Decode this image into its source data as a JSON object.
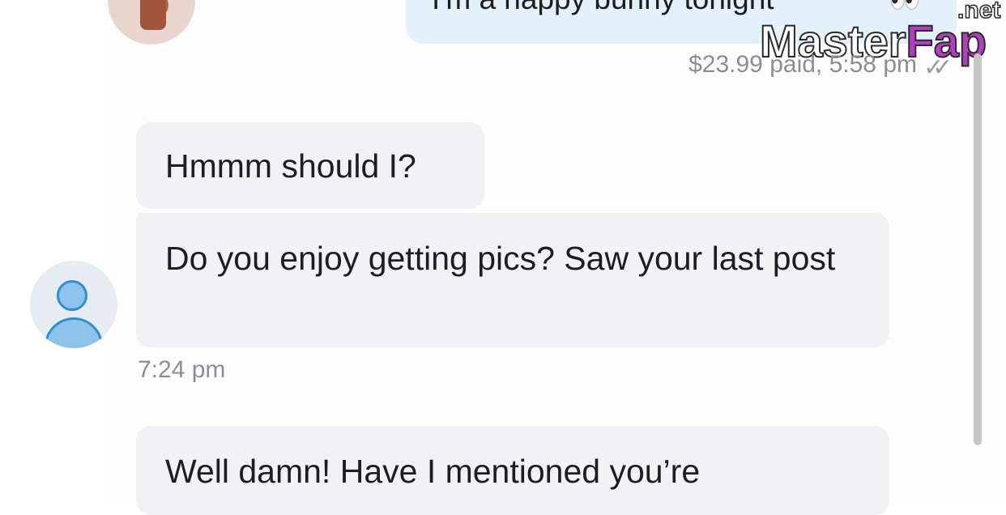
{
  "messages": {
    "outgoing": {
      "text": "I'm a happy bunny tonight",
      "emoji": "👀",
      "meta": "$23.99 paid,  5:58 pm",
      "read_icon": "double-check-icon"
    },
    "incoming": [
      {
        "text": "Hmmm should I?"
      },
      {
        "text": "Do you enjoy getting pics? Saw your last post",
        "time": "7:24 pm"
      },
      {
        "text": "Well damn! Have I mentioned you’re"
      }
    ]
  },
  "watermark": {
    "master": "Master",
    "fap": "Fap",
    "net": ".net"
  },
  "avatars": {
    "sender_photo": "profile-photo",
    "receiver": "default-user-icon"
  },
  "colors": {
    "outgoing_bubble": "#e3f1fb",
    "incoming_bubble": "#f1f2f3",
    "meta_text": "#8a8f94",
    "avatar_accent": "#2f8fd6",
    "watermark_accent": "#b23fbf"
  }
}
